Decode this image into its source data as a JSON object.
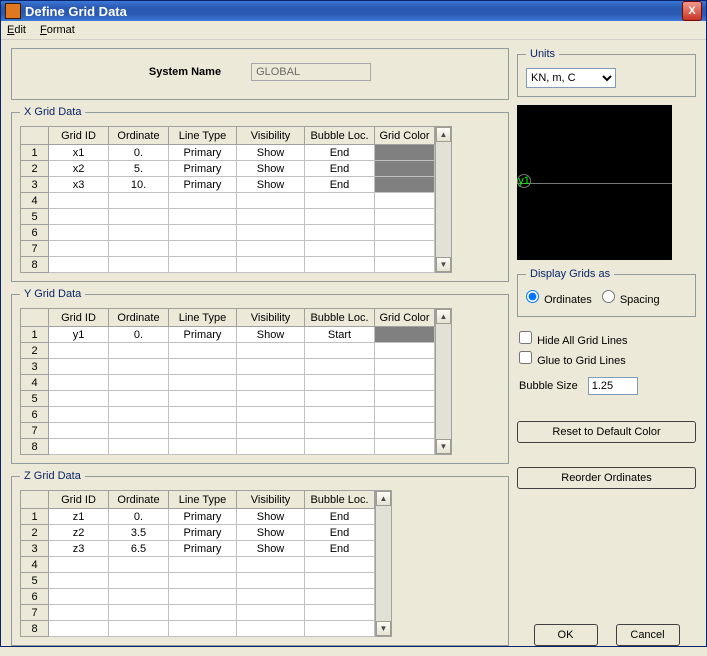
{
  "window": {
    "title": "Define Grid Data",
    "close_icon": "X"
  },
  "menubar": {
    "edit": {
      "accel": "E",
      "rest": "dit"
    },
    "format": {
      "accel": "F",
      "rest": "ormat"
    }
  },
  "system_name": {
    "label": "System Name",
    "value": "GLOBAL"
  },
  "col_headers": {
    "grid_id": "Grid ID",
    "ordinate": "Ordinate",
    "line_type": "Line Type",
    "visibility": "Visibility",
    "bubble_loc": "Bubble Loc.",
    "grid_color": "Grid Color"
  },
  "sections": {
    "x": {
      "legend": "X Grid Data"
    },
    "y": {
      "legend": "Y Grid Data"
    },
    "z": {
      "legend": "Z Grid Data"
    }
  },
  "x_rows": [
    {
      "n": "1",
      "id": "x1",
      "ord": "0.",
      "lt": "Primary",
      "vis": "Show",
      "bub": "End",
      "clr": "grey"
    },
    {
      "n": "2",
      "id": "x2",
      "ord": "5.",
      "lt": "Primary",
      "vis": "Show",
      "bub": "End",
      "clr": "grey"
    },
    {
      "n": "3",
      "id": "x3",
      "ord": "10.",
      "lt": "Primary",
      "vis": "Show",
      "bub": "End",
      "clr": "grey"
    },
    {
      "n": "4"
    },
    {
      "n": "5"
    },
    {
      "n": "6"
    },
    {
      "n": "7"
    },
    {
      "n": "8"
    }
  ],
  "y_rows": [
    {
      "n": "1",
      "id": "y1",
      "ord": "0.",
      "lt": "Primary",
      "vis": "Show",
      "bub": "Start",
      "clr": "grey"
    },
    {
      "n": "2"
    },
    {
      "n": "3"
    },
    {
      "n": "4"
    },
    {
      "n": "5"
    },
    {
      "n": "6"
    },
    {
      "n": "7"
    },
    {
      "n": "8"
    }
  ],
  "z_rows": [
    {
      "n": "1",
      "id": "z1",
      "ord": "0.",
      "lt": "Primary",
      "vis": "Show",
      "bub": "End"
    },
    {
      "n": "2",
      "id": "z2",
      "ord": "3.5",
      "lt": "Primary",
      "vis": "Show",
      "bub": "End"
    },
    {
      "n": "3",
      "id": "z3",
      "ord": "6.5",
      "lt": "Primary",
      "vis": "Show",
      "bub": "End"
    },
    {
      "n": "4"
    },
    {
      "n": "5"
    },
    {
      "n": "6"
    },
    {
      "n": "7"
    },
    {
      "n": "8"
    }
  ],
  "units": {
    "legend": "Units",
    "value": "KN, m, C"
  },
  "display": {
    "legend": "Display Grids as",
    "ordinates": "Ordinates",
    "spacing": "Spacing"
  },
  "options": {
    "hide": "Hide All Grid Lines",
    "glue": "Glue to Grid Lines",
    "bubble_label": "Bubble Size",
    "bubble_value": "1.25"
  },
  "buttons": {
    "reset": "Reset to Default Color",
    "reorder": "Reorder Ordinates",
    "ok": "OK",
    "cancel": "Cancel"
  },
  "preview": {
    "bubble_text": "y1"
  }
}
